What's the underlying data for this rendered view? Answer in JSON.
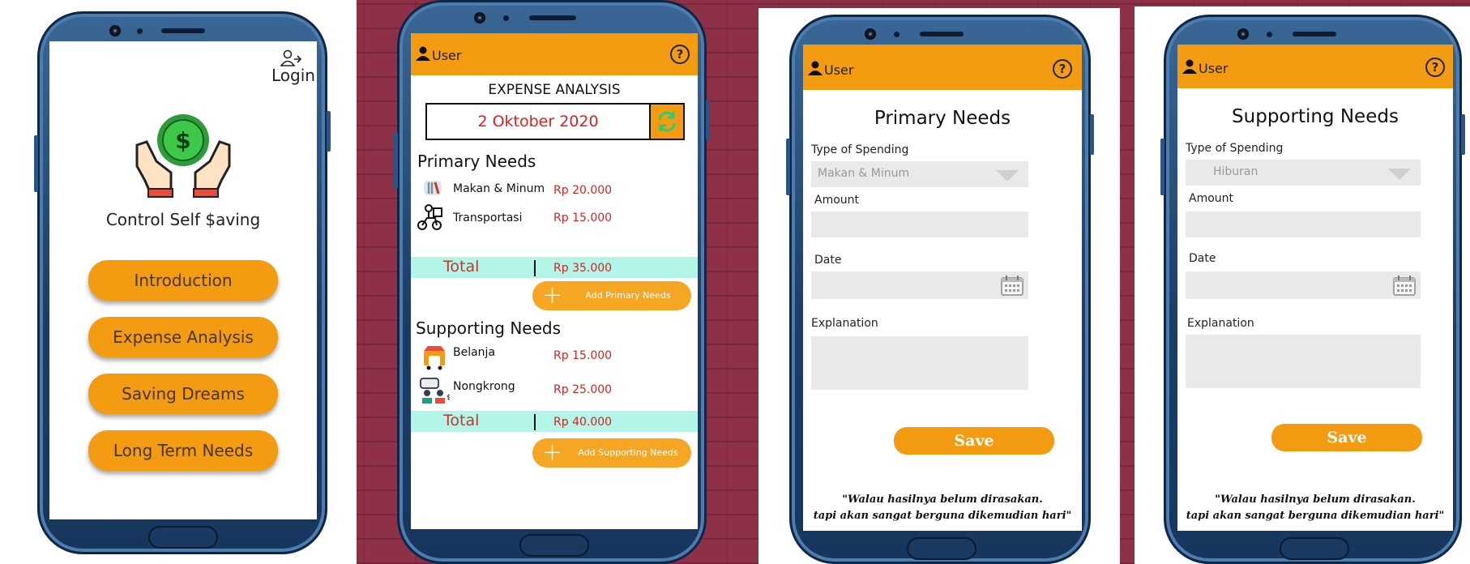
{
  "screen1": {
    "login_label": "Login",
    "app_name": "Control Self $aving",
    "menu": [
      "Introduction",
      "Expense Analysis",
      "Saving Dreams",
      "Long Term Needs"
    ]
  },
  "screen2": {
    "user_label": "User",
    "help_symbol": "?",
    "title": "EXPENSE ANALYSIS",
    "date": "2 Oktober 2020",
    "primary": {
      "title": "Primary Needs",
      "items": [
        {
          "name": "Makan  & Minum",
          "price": "Rp 20.000"
        },
        {
          "name": "Transportasi",
          "price": "Rp 15.000"
        }
      ],
      "total_label": "Total",
      "total_value": "Rp 35.000",
      "add_label": "Add Primary Needs"
    },
    "supporting": {
      "title": "Supporting Needs",
      "items": [
        {
          "name": "Belanja",
          "price": "Rp 15.000"
        },
        {
          "name": "Nongkrong",
          "price": "Rp 25.000"
        }
      ],
      "total_label": "Total",
      "total_value": "Rp 40.000",
      "add_label": "Add Supporting  Needs"
    }
  },
  "screen3": {
    "user_label": "User",
    "help_symbol": "?",
    "title": "Primary Needs",
    "type_label": "Type of Spending",
    "type_value": "Makan & Minum",
    "amount_label": "Amount",
    "date_label": "Date",
    "explanation_label": "Explanation",
    "save_label": "Save",
    "quote_line1": "\"Walau hasilnya belum dirasakan.",
    "quote_line2": "tapi akan sangat berguna dikemudian hari\""
  },
  "screen4": {
    "user_label": "User",
    "help_symbol": "?",
    "title": "Supporting Needs",
    "type_label": "Type of Spending",
    "type_value": "Hiburan",
    "amount_label": "Amount",
    "date_label": "Date",
    "explanation_label": "Explanation",
    "save_label": "Save",
    "quote_line1": "\"Walau hasilnya belum dirasakan.",
    "quote_line2": "tapi akan sangat berguna dikemudian hari\""
  },
  "colors": {
    "accent": "#f39c12",
    "background": "#8e3148",
    "phone_body": "#1d3d66",
    "price_red": "#d8221f",
    "total_bar": "#b3f5e9",
    "coin_green": "#3cc94a"
  }
}
